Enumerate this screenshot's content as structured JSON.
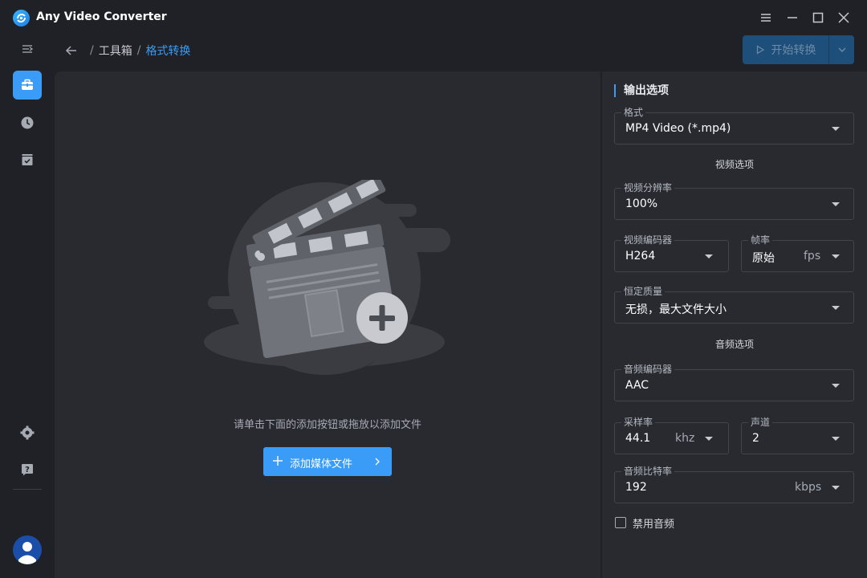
{
  "app": {
    "title": "Any Video Converter"
  },
  "breadcrumb": {
    "items": [
      "工具箱",
      "格式转换"
    ],
    "separator": "/"
  },
  "toolbar": {
    "start_label": "开始转换"
  },
  "sidebar": {
    "items": [
      {
        "name": "menu-collapse-icon"
      },
      {
        "name": "toolbox-icon",
        "active": true
      },
      {
        "name": "history-icon"
      },
      {
        "name": "tasks-icon"
      },
      {
        "name": "settings-icon"
      },
      {
        "name": "help-icon"
      }
    ]
  },
  "dropzone": {
    "hint": "请单击下面的添加按钮或拖放以添加文件",
    "add_label": "添加媒体文件"
  },
  "output": {
    "title": "输出选项",
    "format": {
      "label": "格式",
      "value": "MP4 Video (*.mp4)"
    },
    "video_section": "视频选项",
    "resolution": {
      "label": "视频分辨率",
      "value": "100%"
    },
    "video_codec": {
      "label": "视频编码器",
      "value": "H264"
    },
    "framerate": {
      "label": "帧率",
      "value": "原始",
      "unit": "fps"
    },
    "quality": {
      "label": "恒定质量",
      "value": "无损，最大文件大小"
    },
    "audio_section": "音频选项",
    "audio_codec": {
      "label": "音频编码器",
      "value": "AAC"
    },
    "sample_rate": {
      "label": "采样率",
      "value": "44.1",
      "unit": "khz"
    },
    "channels": {
      "label": "声道",
      "value": "2"
    },
    "bitrate": {
      "label": "音频比特率",
      "value": "192",
      "unit": "kbps"
    },
    "disable_audio": {
      "label": "禁用音频",
      "checked": false
    }
  },
  "colors": {
    "accent": "#3a9cf7",
    "background": "#1f2126",
    "panel": "#282a30"
  }
}
